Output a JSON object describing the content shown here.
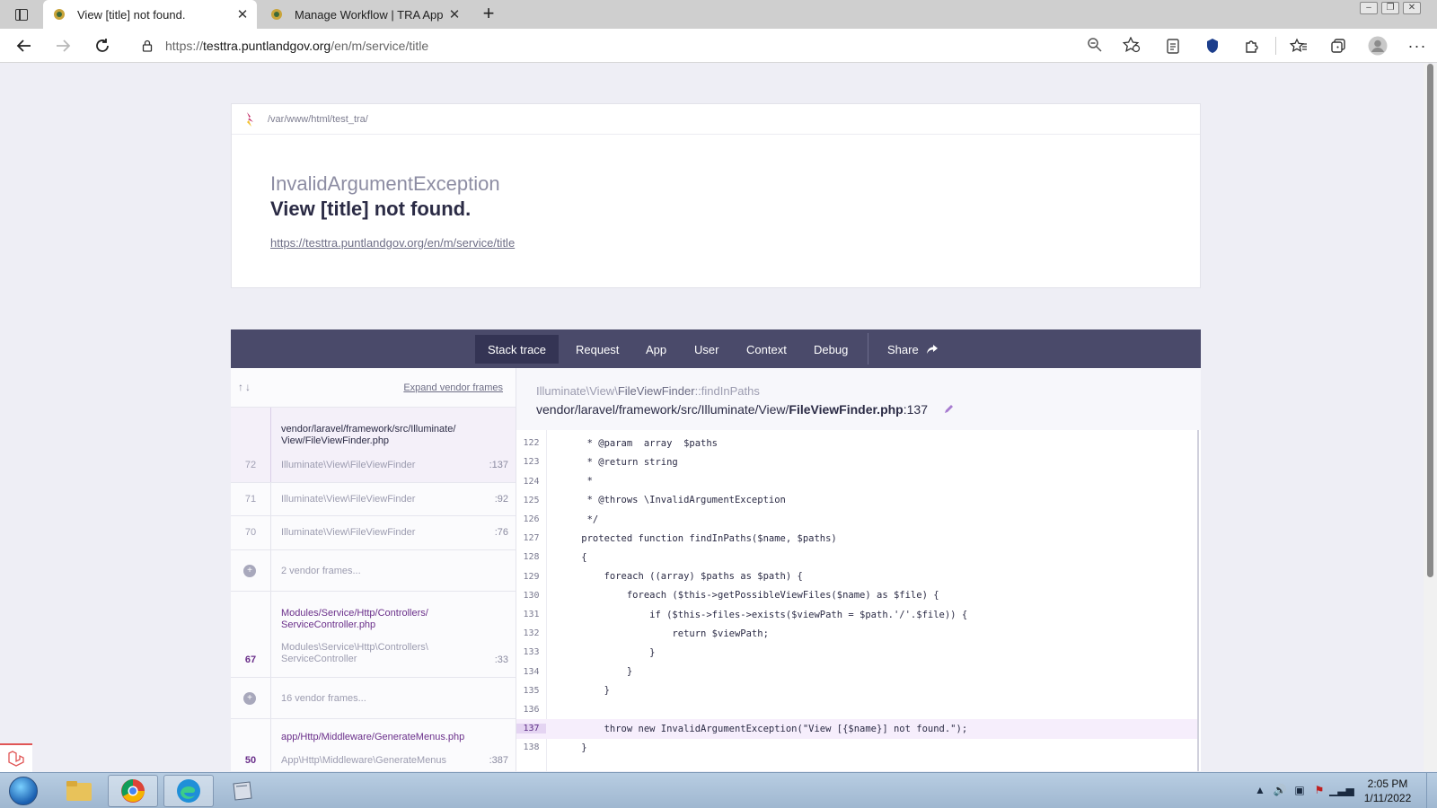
{
  "browser": {
    "tabs": [
      {
        "title": "View [title] not found.",
        "active": true
      },
      {
        "title": "Manage Workflow | TRA App",
        "active": false
      }
    ],
    "url_prefix": "https://",
    "url_host": "testtra.puntlandgov.org",
    "url_path": "/en/m/service/title"
  },
  "error": {
    "path": "/var/www/html/test_tra/",
    "exception_class": "InvalidArgumentException",
    "message": "View [title] not found.",
    "url": "https://testtra.puntlandgov.org/en/m/service/title"
  },
  "nav_tabs": [
    "Stack trace",
    "Request",
    "App",
    "User",
    "Context",
    "Debug"
  ],
  "share_label": "Share",
  "trace": {
    "expand_label": "Expand vendor frames",
    "frames": [
      {
        "num": "72",
        "file_a": "vendor/laravel/framework/src/Illuminate/",
        "file_b": "View/FileViewFinder.php",
        "cls": "Illuminate\\View\\FileViewFinder",
        "line": ":137"
      },
      {
        "num": "71",
        "cls": "Illuminate\\View\\FileViewFinder",
        "line": ":92"
      },
      {
        "num": "70",
        "cls": "Illuminate\\View\\FileViewFinder",
        "line": ":76"
      },
      {
        "vendor": "2 vendor frames..."
      },
      {
        "num": "67",
        "file_a": "Modules/Service/Http/Controllers/",
        "file_b": "ServiceController.php",
        "cls_a": "Modules\\Service\\Http\\Controllers\\",
        "cls_b": "ServiceController",
        "line": ":33"
      },
      {
        "vendor": "16 vendor frames..."
      },
      {
        "num": "50",
        "file_a": "app/Http/Middleware/GenerateMenus.php",
        "cls": "App\\Http\\Middleware\\GenerateMenus",
        "line": ":387"
      }
    ]
  },
  "code": {
    "class_prefix": "Illuminate\\View\\",
    "class_name": "FileViewFinder",
    "method": "::findInPaths",
    "file_prefix": "vendor/laravel/framework/src/Illuminate/View/",
    "file_name": "FileViewFinder.php",
    "file_line": ":137",
    "lines": [
      {
        "no": "122",
        "text": "     * @param  array  $paths"
      },
      {
        "no": "123",
        "text": "     * @return string"
      },
      {
        "no": "124",
        "text": "     *"
      },
      {
        "no": "125",
        "text": "     * @throws \\InvalidArgumentException"
      },
      {
        "no": "126",
        "text": "     */"
      },
      {
        "no": "127",
        "text": "    protected function findInPaths($name, $paths)"
      },
      {
        "no": "128",
        "text": "    {"
      },
      {
        "no": "129",
        "text": "        foreach ((array) $paths as $path) {"
      },
      {
        "no": "130",
        "text": "            foreach ($this->getPossibleViewFiles($name) as $file) {"
      },
      {
        "no": "131",
        "text": "                if ($this->files->exists($viewPath = $path.'/'.$file)) {"
      },
      {
        "no": "132",
        "text": "                    return $viewPath;"
      },
      {
        "no": "133",
        "text": "                }"
      },
      {
        "no": "134",
        "text": "            }"
      },
      {
        "no": "135",
        "text": "        }"
      },
      {
        "no": "136",
        "text": ""
      },
      {
        "no": "137",
        "text": "        throw new InvalidArgumentException(\"View [{$name}] not found.\");"
      },
      {
        "no": "138",
        "text": "    }"
      }
    ],
    "highlight": "137"
  },
  "taskbar": {
    "time": "2:05 PM",
    "date": "1/11/2022"
  }
}
